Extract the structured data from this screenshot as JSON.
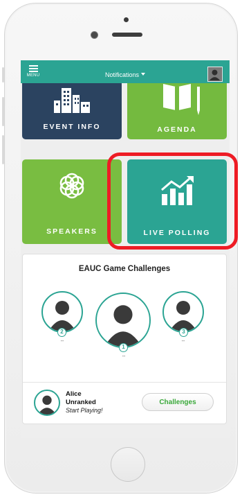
{
  "header": {
    "menu_label": "MENU",
    "notifications_label": "Notifications"
  },
  "tiles": {
    "event_info": "EVENT INFO",
    "agenda": "AGENDA",
    "speakers": "SPEAKERS",
    "live_polling": "LIVE POLLING"
  },
  "game": {
    "title": "EAUC Game Challenges",
    "leaders": [
      {
        "rank": "2",
        "score": "--"
      },
      {
        "rank": "1",
        "score": "--"
      },
      {
        "rank": "3",
        "score": "--"
      }
    ],
    "user": {
      "name": "Alice",
      "rank": "Unranked",
      "cta": "Start Playing!"
    },
    "challenges_button": "Challenges"
  },
  "colors": {
    "topbar": "#2ba493",
    "event_tile": "#2b4360",
    "agenda_tile": "#74ba3f",
    "speakers_tile": "#79bd41",
    "polling_tile": "#2ba493",
    "highlight": "#ee1c25",
    "challenge_text": "#3aa83a"
  },
  "icons": {
    "menu": "hamburger-icon",
    "event_info": "city-buildings-icon",
    "agenda": "open-book-icon",
    "speakers": "flower-of-life-icon",
    "live_polling": "bar-chart-trend-icon",
    "profile": "person-silhouette-icon"
  }
}
